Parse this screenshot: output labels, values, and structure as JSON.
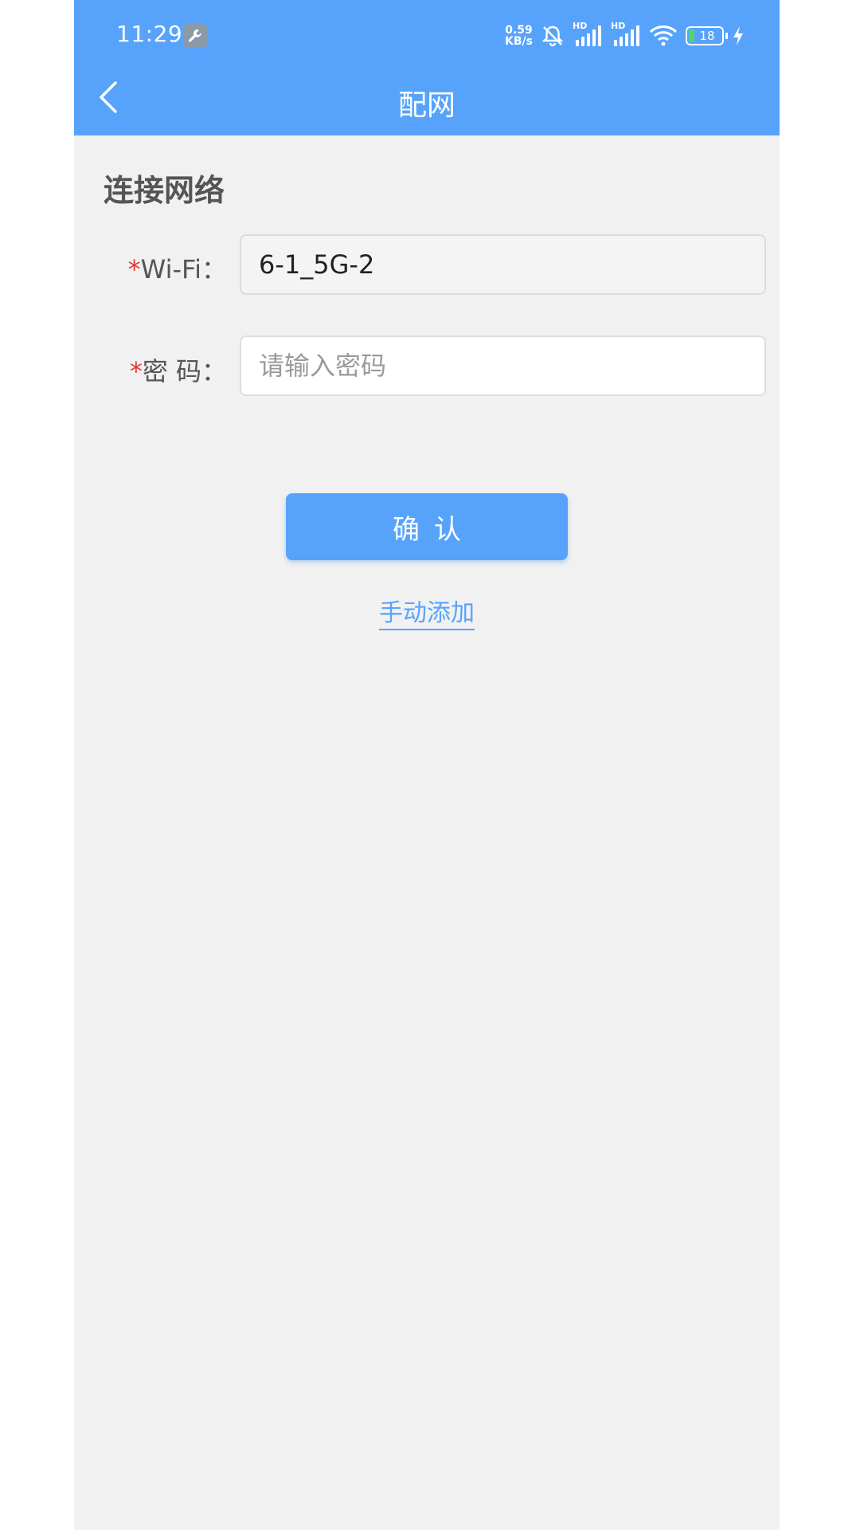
{
  "status_bar": {
    "time": "11:29",
    "net_speed_value": "0.59",
    "net_speed_unit": "KB/s",
    "battery": "18",
    "sim_badge_1": "HD",
    "sim_badge_2": "HD"
  },
  "header": {
    "title": "配网"
  },
  "form": {
    "section_title": "连接网络",
    "required_mark": "*",
    "wifi_label": "Wi-Fi：",
    "wifi_value": "6-1_5G-2",
    "password_label": "密 码：",
    "password_placeholder": "请输入密码"
  },
  "actions": {
    "confirm_label": "确认",
    "manual_add_label": "手动添加"
  },
  "colors": {
    "primary": "#57a3fc",
    "background": "#f1f1f2",
    "required": "#e53935"
  }
}
